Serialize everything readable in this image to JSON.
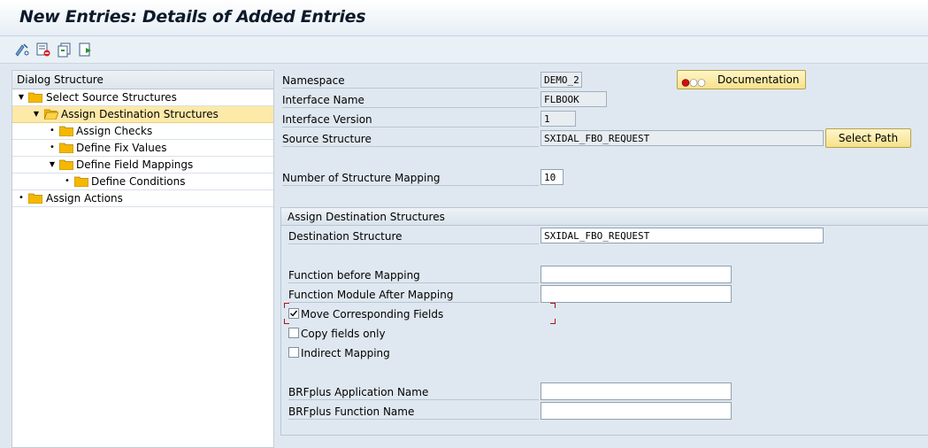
{
  "window": {
    "title": "New Entries: Details of Added Entries"
  },
  "toolbar": {
    "icons": [
      "display-change-icon",
      "delete-row-icon",
      "copy-entry-icon",
      "next-entry-icon"
    ]
  },
  "tree": {
    "header": "Dialog Structure",
    "items": [
      {
        "label": "Select Source Structures",
        "level": 0,
        "state": "expanded",
        "open": false,
        "selected": false
      },
      {
        "label": "Assign Destination Structures",
        "level": 1,
        "state": "expanded",
        "open": true,
        "selected": true
      },
      {
        "label": "Assign Checks",
        "level": 2,
        "state": "leaf",
        "open": false,
        "selected": false
      },
      {
        "label": "Define Fix Values",
        "level": 2,
        "state": "leaf",
        "open": false,
        "selected": false
      },
      {
        "label": "Define Field Mappings",
        "level": 2,
        "state": "expanded",
        "open": false,
        "selected": false
      },
      {
        "label": "Define Conditions",
        "level": 3,
        "state": "leaf",
        "open": false,
        "selected": false
      },
      {
        "label": "Assign Actions",
        "level": 0,
        "state": "leaf",
        "open": false,
        "selected": false
      }
    ]
  },
  "header_fields": {
    "namespace": {
      "label": "Namespace",
      "value": "DEMO_2"
    },
    "interface_name": {
      "label": "Interface Name",
      "value": "FLBOOK"
    },
    "interface_version": {
      "label": "Interface Version",
      "value": "1"
    },
    "source_structure": {
      "label": "Source Structure",
      "value": "SXIDAL_FBO_REQUEST"
    },
    "number_of_mapping": {
      "label": "Number of Structure Mapping",
      "value": "10"
    },
    "documentation_button": "Documentation",
    "select_path_button": "Select Path"
  },
  "group": {
    "title": "Assign Destination Structures",
    "destination_structure": {
      "label": "Destination Structure",
      "value": "SXIDAL_FBO_REQUEST"
    },
    "function_before": {
      "label": "Function before Mapping",
      "value": ""
    },
    "function_after": {
      "label": "Function Module After Mapping",
      "value": ""
    },
    "move_corresponding": {
      "label": "Move Corresponding Fields",
      "checked": true
    },
    "copy_fields_only": {
      "label": "Copy fields only",
      "checked": false
    },
    "indirect_mapping": {
      "label": "Indirect Mapping",
      "checked": false
    },
    "brf_app_name": {
      "label": "BRFplus Application Name",
      "value": ""
    },
    "brf_function_name": {
      "label": "BRFplus Function Name",
      "value": ""
    }
  },
  "colors": {
    "background": "#dfe8f0",
    "selection": "#fde9a8",
    "button": "#f6e28a",
    "folder": "#f5b800"
  }
}
